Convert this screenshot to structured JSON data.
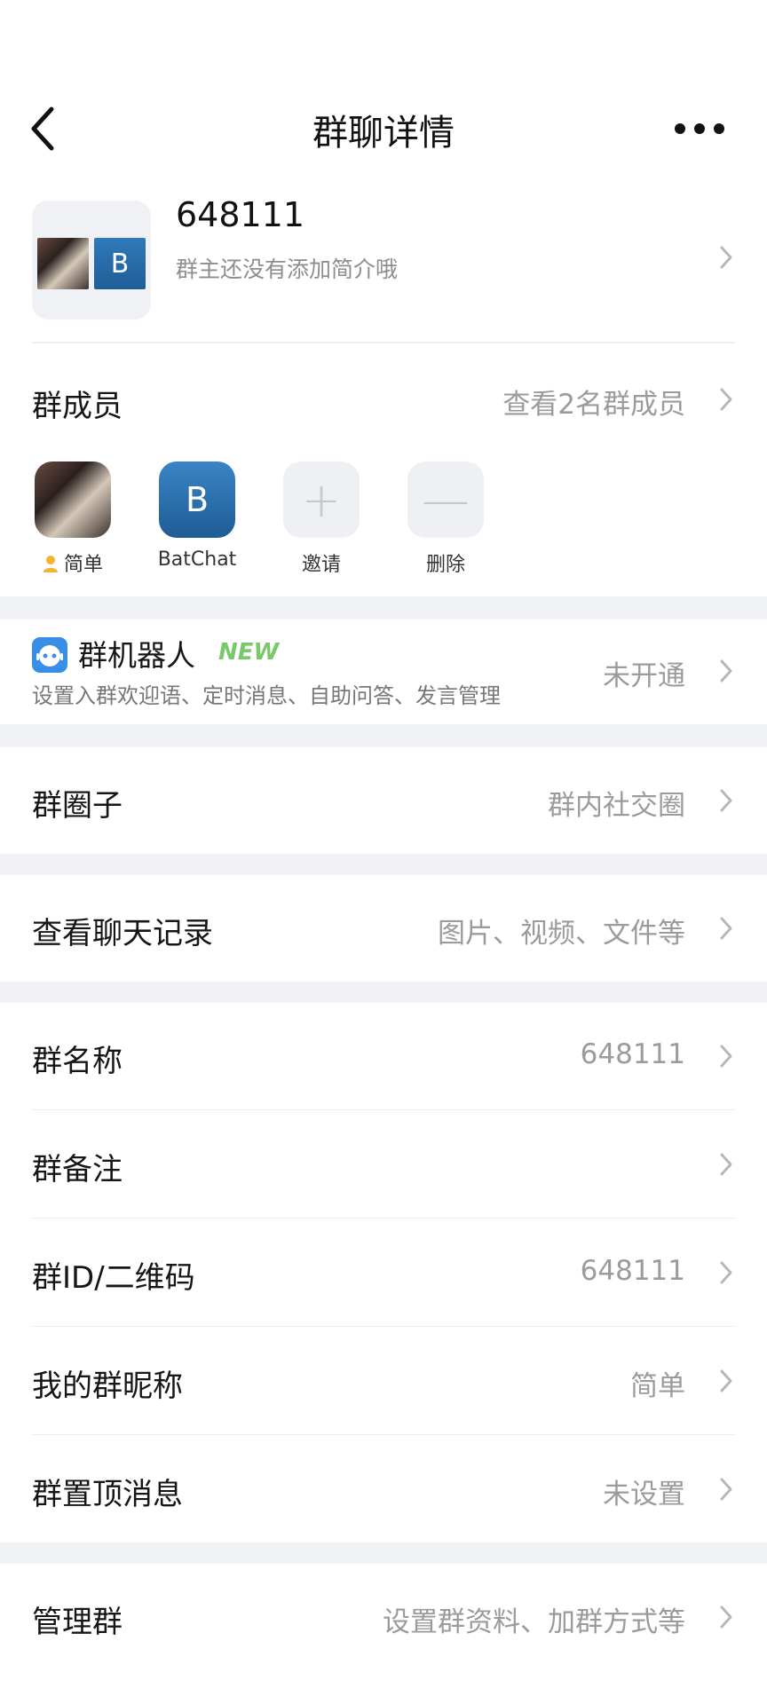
{
  "header": {
    "title": "群聊详情"
  },
  "group": {
    "name": "648111",
    "description": "群主还没有添加简介哦",
    "avatar_letter": "B"
  },
  "members_section": {
    "label": "群成员",
    "summary": "查看2名群成员",
    "members": [
      {
        "name": "简单",
        "avatar": "photo"
      },
      {
        "name": "BatChat",
        "avatar_letter": "B"
      }
    ],
    "invite_label": "邀请",
    "delete_label": "删除",
    "invite_symbol": "+",
    "delete_symbol": "—"
  },
  "robot": {
    "title": "群机器人",
    "badge": "NEW",
    "description": "设置入群欢迎语、定时消息、自助问答、发言管理",
    "status": "未开通"
  },
  "items": [
    {
      "label": "群圈子",
      "value": "群内社交圈"
    },
    {
      "label": "查看聊天记录",
      "value": "图片、视频、文件等"
    },
    {
      "label": "群名称",
      "value": "648111"
    },
    {
      "label": "群备注",
      "value": ""
    },
    {
      "label": "群ID/二维码",
      "value": "648111"
    },
    {
      "label": "我的群昵称",
      "value": "简单"
    },
    {
      "label": "群置顶消息",
      "value": "未设置"
    },
    {
      "label": "管理群",
      "value": "设置群资料、加群方式等"
    }
  ],
  "colors": {
    "separator": "#f1f2f6",
    "accent_new": "#7bc86a",
    "avatar_blue": "#2f7ab9"
  }
}
